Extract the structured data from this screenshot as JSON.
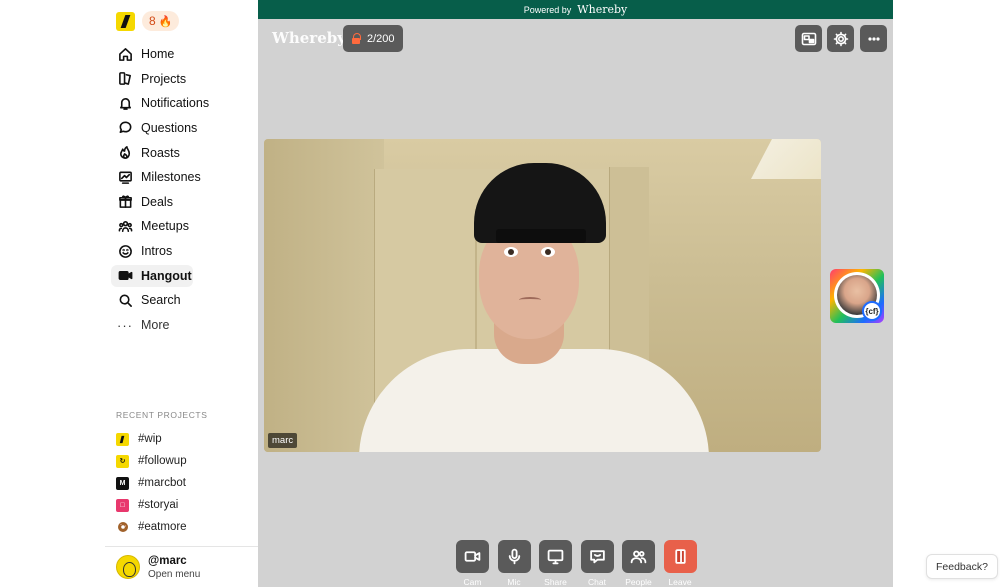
{
  "header": {
    "streak_count": "8"
  },
  "nav": {
    "items": [
      {
        "label": "Home",
        "icon": "home-icon"
      },
      {
        "label": "Projects",
        "icon": "projects-icon"
      },
      {
        "label": "Notifications",
        "icon": "bell-icon"
      },
      {
        "label": "Questions",
        "icon": "chat-bubble-icon"
      },
      {
        "label": "Roasts",
        "icon": "flame-icon"
      },
      {
        "label": "Milestones",
        "icon": "chart-icon"
      },
      {
        "label": "Deals",
        "icon": "gift-icon"
      },
      {
        "label": "Meetups",
        "icon": "people-icon"
      },
      {
        "label": "Intros",
        "icon": "smile-icon"
      },
      {
        "label": "Hangout",
        "icon": "video-icon",
        "active": true
      },
      {
        "label": "Search",
        "icon": "search-icon"
      },
      {
        "label": "More",
        "icon": "more-icon"
      }
    ]
  },
  "recent_projects": {
    "title": "RECENT PROJECTS",
    "items": [
      {
        "label": "#wip",
        "color": "#f5d800"
      },
      {
        "label": "#followup",
        "color": "#f5d800"
      },
      {
        "label": "#marcbot",
        "color": "#111111"
      },
      {
        "label": "#storyai",
        "color": "#e8386d"
      },
      {
        "label": "#eatmore",
        "color": "#8a5a2b"
      }
    ]
  },
  "profile": {
    "handle": "@marc",
    "sub": "Open menu"
  },
  "meeting": {
    "powered_by": "Powered by",
    "brand": "Whereby",
    "watermark": "Whereby",
    "participants": "2/200",
    "participant_name": "marc",
    "thumb_badge": "{cf}",
    "controls": [
      {
        "label": "Cam",
        "icon": "camera-icon"
      },
      {
        "label": "Mic",
        "icon": "mic-icon"
      },
      {
        "label": "Share",
        "icon": "screen-share-icon"
      },
      {
        "label": "Chat",
        "icon": "chat-icon"
      },
      {
        "label": "People",
        "icon": "people-icon"
      },
      {
        "label": "Leave",
        "icon": "leave-icon"
      }
    ],
    "accent": "#075e4a"
  },
  "feedback": {
    "label": "Feedback?"
  }
}
